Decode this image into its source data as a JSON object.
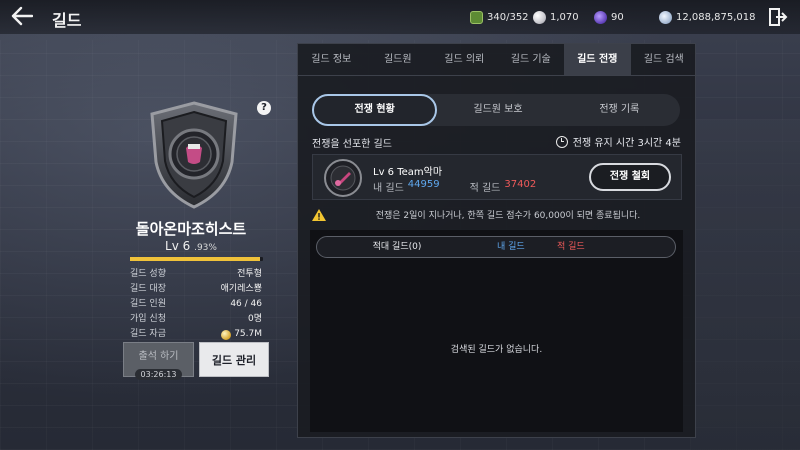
{
  "header": {
    "title": "길드",
    "resources": [
      {
        "icon": "energy-icon",
        "value": "340/352"
      },
      {
        "icon": "pearl-icon",
        "value": "1,070"
      },
      {
        "icon": "purple-gem-icon",
        "value": "90"
      },
      {
        "icon": "silver-coin-icon",
        "value": "12,088,875,018"
      }
    ]
  },
  "guild": {
    "name": "돌아온마조히스트",
    "level": "Lv 6",
    "exp_percent": ".93%",
    "exp_fraction": 0.98,
    "info": [
      {
        "label": "길드 성향",
        "value": "전투형"
      },
      {
        "label": "길드 대장",
        "value": "애기레스뿅"
      },
      {
        "label": "길드 인원",
        "value": "46 / 46"
      },
      {
        "label": "가입 신청",
        "value": "0명"
      },
      {
        "label": "길드 자금",
        "value": "75.7M"
      }
    ],
    "attend_label": "출석 하기",
    "attend_timer": "03:26:13",
    "manage_label": "길드 관리"
  },
  "tabs": [
    "길드 정보",
    "길드원",
    "길드 의뢰",
    "길드 기술",
    "길드 전쟁",
    "길드 검색"
  ],
  "active_tab": 4,
  "subtabs": [
    "전쟁 현황",
    "길드원 보호",
    "전쟁 기록"
  ],
  "war": {
    "declared_label": "전쟁을 선포한 길드",
    "duration": "전쟁 유지 시간 3시간 4분",
    "enemy": {
      "name": "Lv 6 Team악마",
      "my_label": "내 길드",
      "my_score": "44959",
      "enemy_label": "적 길드",
      "enemy_score": "37402"
    },
    "withdraw_label": "전쟁 철회",
    "notice": "전쟁은 2일이 지나거나, 한쪽 길드 점수가 60,000이 되면 종료됩니다.",
    "list_headers": {
      "hostile": "적대 길드(0)",
      "mine": "내 길드",
      "enemy": "적 길드"
    },
    "empty_message": "검색된 길드가 없습니다."
  },
  "colors": {
    "accent_blue": "#5fa8ef",
    "accent_red": "#ef5a5a",
    "exp_gold": "#f0c23a"
  }
}
